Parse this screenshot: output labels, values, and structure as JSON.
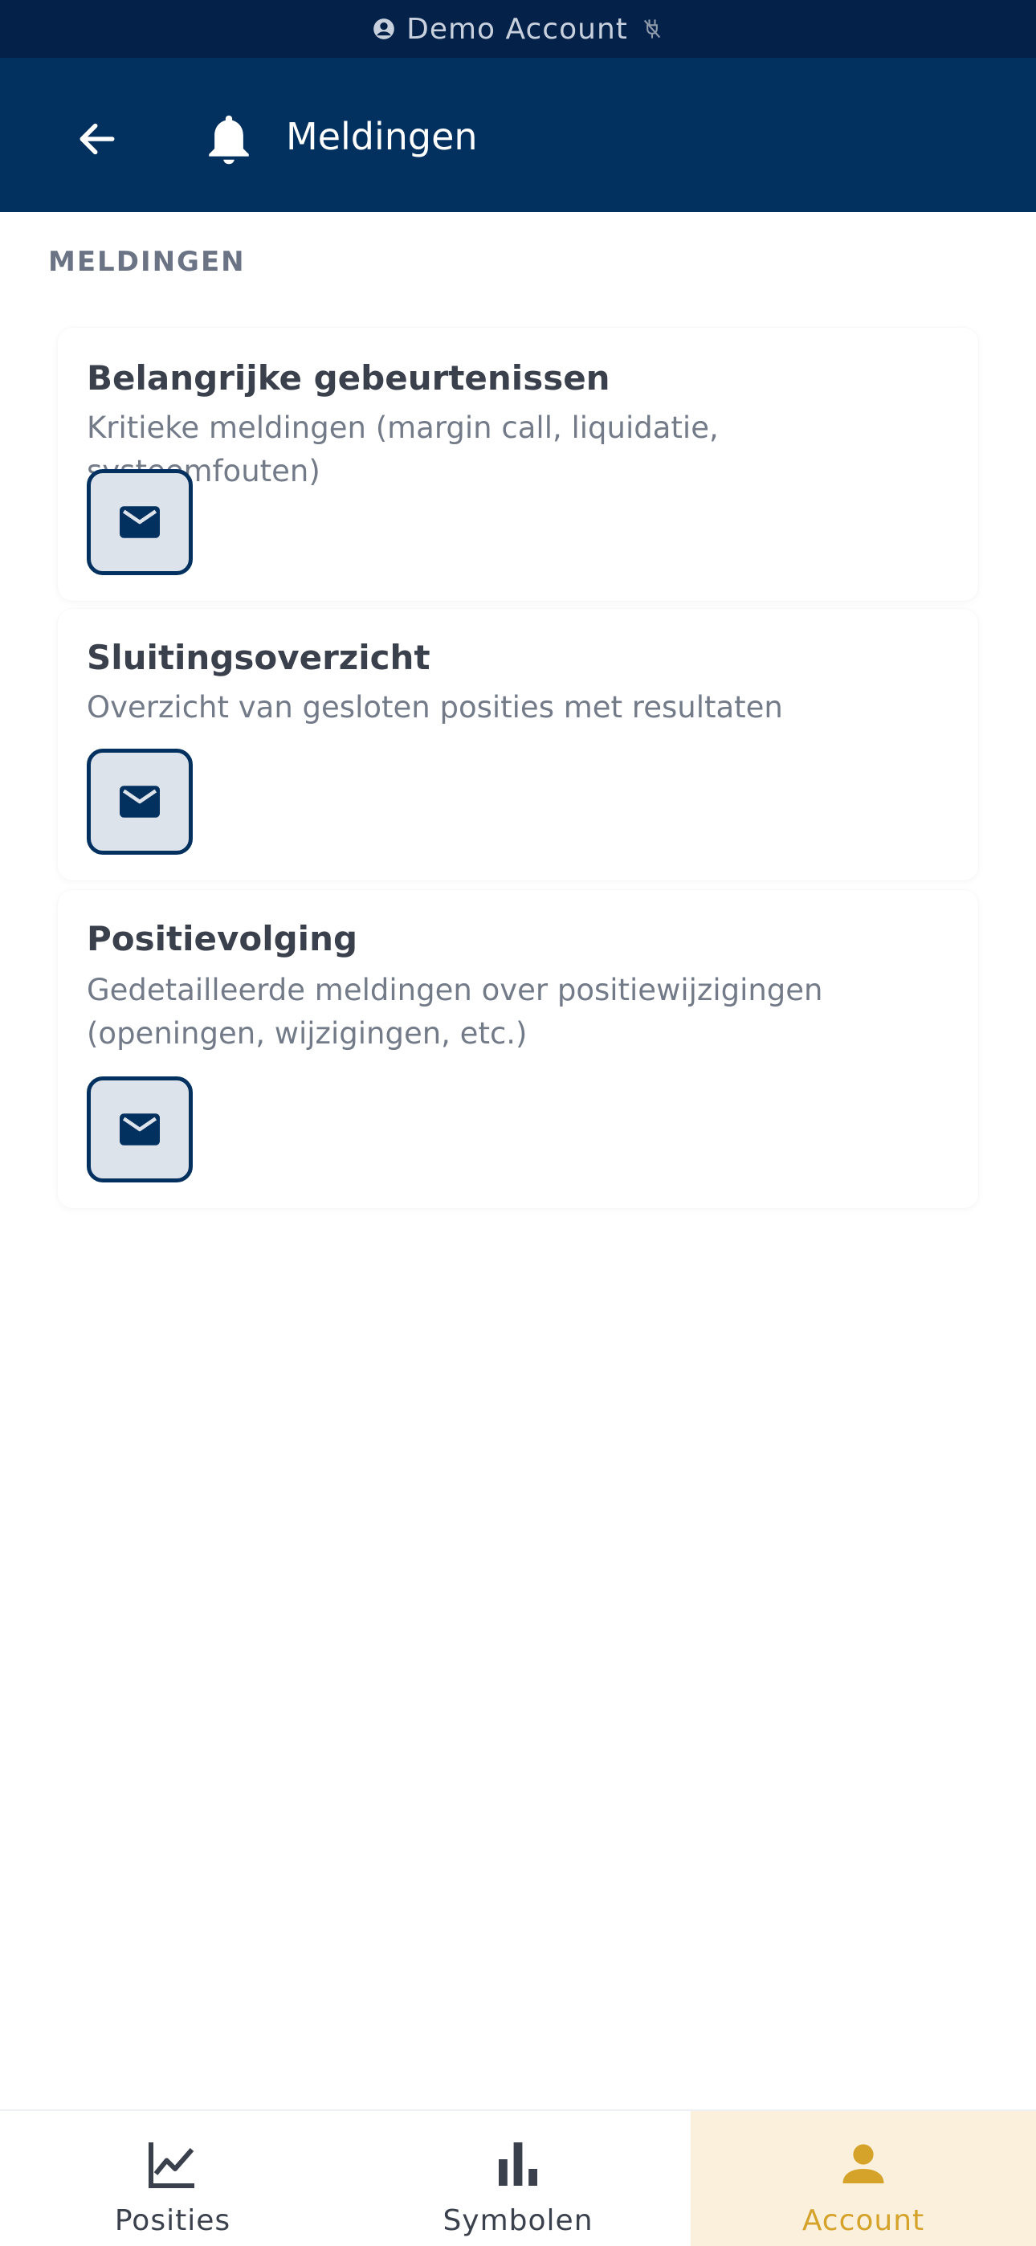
{
  "status_bar": {
    "account_label": "Demo Account",
    "account_icon": "account-circle-icon",
    "connection_icon": "offline-icon"
  },
  "header": {
    "back_icon": "arrow-left-icon",
    "bell_icon": "bell-icon",
    "title": "Meldingen"
  },
  "section": {
    "label": "MELDINGEN"
  },
  "cards": [
    {
      "title": "Belangrijke gebeurtenissen",
      "description": "Kritieke meldingen (margin call, liquidatie, systeemfouten)",
      "channel_icon": "mail-icon"
    },
    {
      "title": "Sluitingsoverzicht",
      "description": "Overzicht van gesloten posities met resultaten",
      "channel_icon": "mail-icon"
    },
    {
      "title": "Positievolging",
      "description": "Gedetailleerde meldingen over positiewijzigingen (openingen, wijzigingen, etc.)",
      "channel_icon": "mail-icon"
    }
  ],
  "bottom_nav": {
    "items": [
      {
        "label": "Posities",
        "icon": "line-chart-icon",
        "active": false
      },
      {
        "label": "Symbolen",
        "icon": "bar-chart-icon",
        "active": false
      },
      {
        "label": "Account",
        "icon": "person-icon",
        "active": true
      }
    ]
  },
  "colors": {
    "status_bar_bg": "#04214a",
    "header_bg": "#03315f",
    "accent_gold": "#d6a32a",
    "active_nav_bg": "#faf0dc",
    "mail_button_bg": "#dde3ea"
  }
}
